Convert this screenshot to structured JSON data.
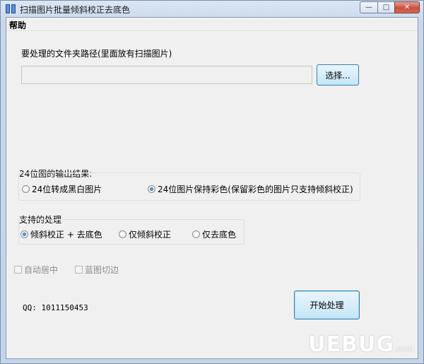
{
  "window": {
    "title": "扫描图片批量倾斜校正去底色",
    "controls": {
      "minimize": "—",
      "maximize": "□",
      "close": "✕"
    }
  },
  "menu": {
    "help": "帮助"
  },
  "folder": {
    "label": "要处理的文件夹路径(里面放有扫描图片)",
    "path_value": "",
    "select_button": "选择..."
  },
  "output_group": {
    "title": "24位图的输出结果:",
    "options": [
      {
        "label": "24位转成黑白图片",
        "selected": false
      },
      {
        "label": "24位图片保持彩色(保留彩色的图片只支持倾斜校正)",
        "selected": true
      }
    ]
  },
  "process_group": {
    "title": "支持的处理",
    "options": [
      {
        "label": "倾斜校正 + 去底色",
        "selected": true
      },
      {
        "label": "仅倾斜校正",
        "selected": false
      },
      {
        "label": "仅去底色",
        "selected": false
      }
    ]
  },
  "checks": {
    "auto_center": "自动居中",
    "blue_trim": "蓝图切边"
  },
  "qq": "QQ: 1011150453",
  "start_button": "开始处理",
  "watermark": {
    "main": "UEBUG",
    "sub": ".com"
  },
  "colors": {
    "accent_blue": "#3c7fb1",
    "close_red": "#c7503c"
  },
  "icons": {
    "app": "app-icon",
    "minimize": "minimize-icon",
    "maximize": "maximize-icon",
    "close": "close-icon"
  }
}
